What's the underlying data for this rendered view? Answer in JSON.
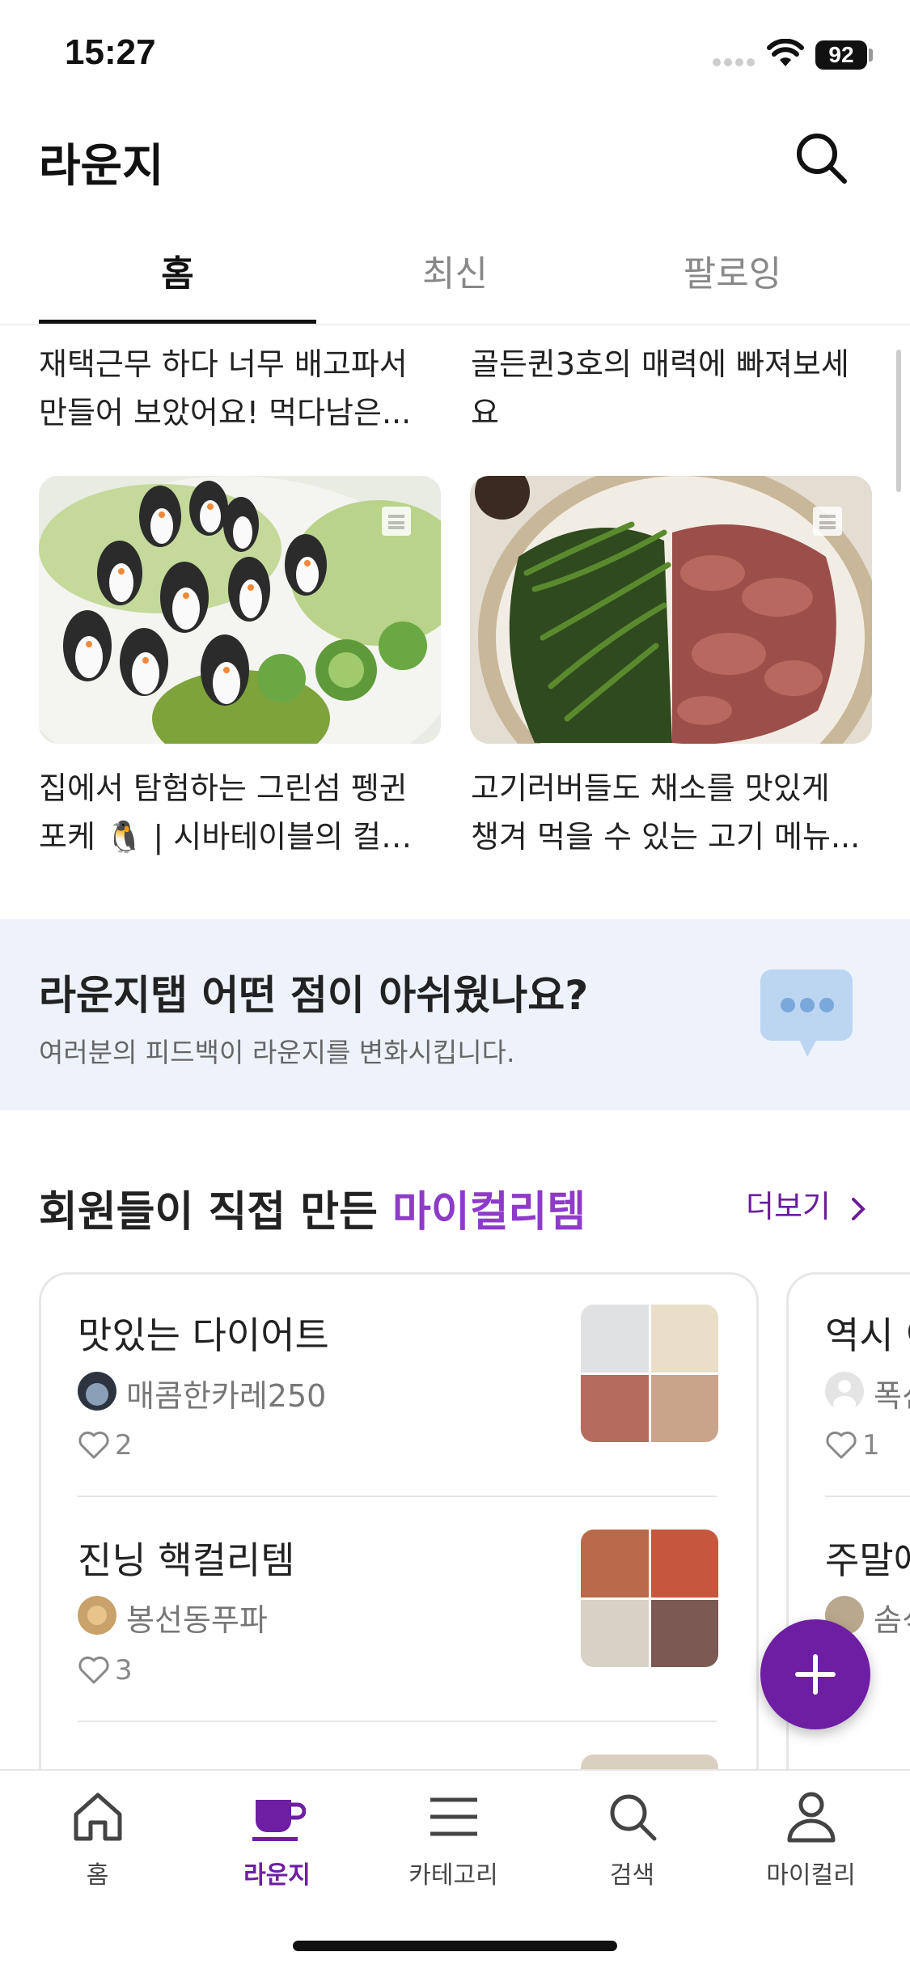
{
  "status_bar": {
    "time": "15:27",
    "battery": "92"
  },
  "header": {
    "title": "라운지"
  },
  "tabs": [
    {
      "label": "홈"
    },
    {
      "label": "최신"
    },
    {
      "label": "팔로잉"
    }
  ],
  "posts_top": [
    {
      "line1": "재택근무 하다 너무 배고파서",
      "line2": "만들어 보았어요!  먹다남은..."
    },
    {
      "line1": "골든퀸3호의 매력에 빠져보세",
      "line2": "요"
    }
  ],
  "posts": [
    {
      "line1": "집에서 탐험하는 그린섬 펭귄",
      "line2": "포케 🐧 | 시바테이블의 컬…"
    },
    {
      "line1": "고기러버들도 채소를 맛있게",
      "line2": "챙겨 먹을 수 있는 고기 메뉴..."
    }
  ],
  "feedback": {
    "title": "라운지탭 어떤 점이 아쉬웠나요?",
    "subtitle": "여러분의 피드백이 라운지를 변화시킵니다."
  },
  "section": {
    "title_prefix": "회원들이 직접 만든 ",
    "title_accent": "마이컬리템",
    "more_label": "더보기"
  },
  "curated_cards": [
    {
      "items": [
        {
          "title": "맛있는 다이어트",
          "author": "매콤한카레250",
          "likes": "2"
        },
        {
          "title": "진닝 핵컬리템",
          "author": "봉선동푸파",
          "likes": "3"
        }
      ]
    },
    {
      "items": [
        {
          "title": "역시 이",
          "author": "폭신",
          "likes": "1"
        },
        {
          "title": "주말에",
          "author": "솜식",
          "likes": ""
        }
      ]
    }
  ],
  "bottom_nav": [
    {
      "label": "홈",
      "icon": "home-icon"
    },
    {
      "label": "라운지",
      "icon": "coffee-cup-icon"
    },
    {
      "label": "카테고리",
      "icon": "menu-icon"
    },
    {
      "label": "검색",
      "icon": "search-icon"
    },
    {
      "label": "마이컬리",
      "icon": "person-icon"
    }
  ],
  "colors": {
    "brand": "#6e1ea3",
    "accent": "#8e3bc9",
    "banner_bg": "#eef3fb"
  }
}
